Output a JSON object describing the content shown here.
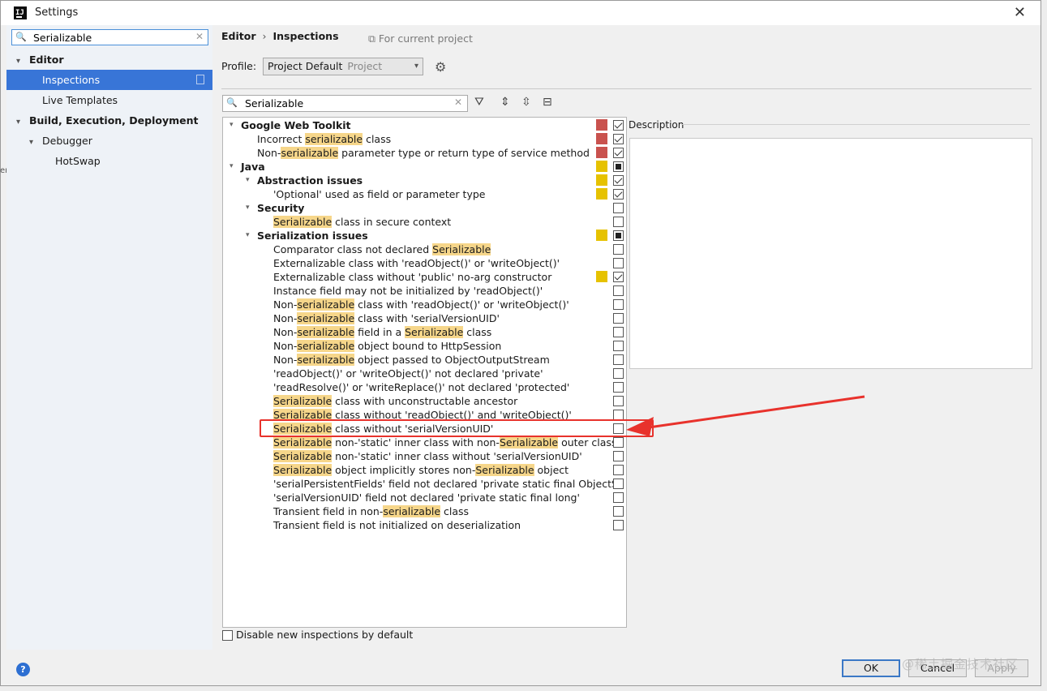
{
  "window": {
    "title": "Settings"
  },
  "sidebar": {
    "search_value": "Serializable",
    "items": [
      {
        "label": "Editor",
        "level": 0,
        "expanded": true,
        "bold": true,
        "selected": false
      },
      {
        "label": "Inspections",
        "level": 1,
        "selected": true
      },
      {
        "label": "Live Templates",
        "level": 1,
        "selected": false
      },
      {
        "label": "Build, Execution, Deployment",
        "level": 0,
        "expanded": true,
        "bold": true,
        "selected": false
      },
      {
        "label": "Debugger",
        "level": 1,
        "expanded": true,
        "selected": false
      },
      {
        "label": "HotSwap",
        "level": 2,
        "selected": false
      }
    ]
  },
  "header": {
    "crumb_editor": "Editor",
    "crumb_inspections": "Inspections",
    "for_project": "For current project",
    "profile_label": "Profile:",
    "profile_value": "Project Default",
    "profile_sub": "Project"
  },
  "filter": {
    "value": "Serializable"
  },
  "highlight_term": "Serializable",
  "inspections": [
    {
      "level": 0,
      "group": true,
      "expanded": true,
      "label": "Google Web Toolkit",
      "severity": "#c9524e",
      "checked": "on"
    },
    {
      "level": 1,
      "label": "Incorrect serializable class",
      "severity": "#c9524e",
      "checked": "on"
    },
    {
      "level": 1,
      "label": "Non-serializable parameter type or return type of service method",
      "severity": "#c9524e",
      "checked": "on"
    },
    {
      "level": 0,
      "group": true,
      "expanded": true,
      "label": "Java",
      "severity": "#e6c200",
      "checked": "mix"
    },
    {
      "level": 1,
      "group": true,
      "expanded": true,
      "label": "Abstraction issues",
      "severity": "#e6c200",
      "checked": "on"
    },
    {
      "level": 2,
      "label": "'Optional' used as field or parameter type",
      "severity": "#e6c200",
      "checked": "on"
    },
    {
      "level": 1,
      "group": true,
      "expanded": true,
      "label": "Security",
      "severity": "",
      "checked": "off"
    },
    {
      "level": 2,
      "label": "Serializable class in secure context",
      "severity": "",
      "checked": "off"
    },
    {
      "level": 1,
      "group": true,
      "expanded": true,
      "label": "Serialization issues",
      "severity": "#e6c200",
      "checked": "mix"
    },
    {
      "level": 2,
      "label": "Comparator class not declared Serializable",
      "severity": "",
      "checked": "off"
    },
    {
      "level": 2,
      "label": "Externalizable class with 'readObject()' or 'writeObject()'",
      "severity": "",
      "checked": "off"
    },
    {
      "level": 2,
      "label": "Externalizable class without 'public' no-arg constructor",
      "severity": "#e6c200",
      "checked": "on"
    },
    {
      "level": 2,
      "label": "Instance field may not be initialized by 'readObject()'",
      "severity": "",
      "checked": "off"
    },
    {
      "level": 2,
      "label": "Non-serializable class with 'readObject()' or 'writeObject()'",
      "severity": "",
      "checked": "off"
    },
    {
      "level": 2,
      "label": "Non-serializable class with 'serialVersionUID'",
      "severity": "",
      "checked": "off"
    },
    {
      "level": 2,
      "label": "Non-serializable field in a Serializable class",
      "severity": "",
      "checked": "off"
    },
    {
      "level": 2,
      "label": "Non-serializable object bound to HttpSession",
      "severity": "",
      "checked": "off"
    },
    {
      "level": 2,
      "label": "Non-serializable object passed to ObjectOutputStream",
      "severity": "",
      "checked": "off"
    },
    {
      "level": 2,
      "label": "'readObject()' or 'writeObject()' not declared 'private'",
      "severity": "",
      "checked": "off"
    },
    {
      "level": 2,
      "label": "'readResolve()' or 'writeReplace()' not declared 'protected'",
      "severity": "",
      "checked": "off"
    },
    {
      "level": 2,
      "label": "Serializable class with unconstructable ancestor",
      "severity": "",
      "checked": "off"
    },
    {
      "level": 2,
      "label": "Serializable class without 'readObject()' and 'writeObject()'",
      "severity": "",
      "checked": "off"
    },
    {
      "level": 2,
      "label": "Serializable class without 'serialVersionUID'",
      "severity": "",
      "checked": "off"
    },
    {
      "level": 2,
      "label": "Serializable non-'static' inner class with non-Serializable outer class",
      "severity": "",
      "checked": "off"
    },
    {
      "level": 2,
      "label": "Serializable non-'static' inner class without 'serialVersionUID'",
      "severity": "",
      "checked": "off"
    },
    {
      "level": 2,
      "label": "Serializable object implicitly stores non-Serializable object",
      "severity": "",
      "checked": "off"
    },
    {
      "level": 2,
      "label": "'serialPersistentFields' field not declared 'private static final ObjectSt",
      "severity": "",
      "checked": "off"
    },
    {
      "level": 2,
      "label": "'serialVersionUID' field not declared 'private static final long'",
      "severity": "",
      "checked": "off"
    },
    {
      "level": 2,
      "label": "Transient field in non-serializable class",
      "severity": "",
      "checked": "off"
    },
    {
      "level": 2,
      "label": "Transient field is not initialized on deserialization",
      "severity": "",
      "checked": "off"
    }
  ],
  "description": {
    "label": "Description"
  },
  "footer": {
    "disable_new_label": "Disable new inspections by default",
    "ok_label": "OK",
    "cancel_label": "Cancel",
    "apply_label": "Apply",
    "help_label": "?"
  },
  "watermark": "@稀土掘金技术社区",
  "colors": {
    "accent": "#3875d7",
    "highlight": "#f6d68a",
    "callout": "#e8322c"
  }
}
